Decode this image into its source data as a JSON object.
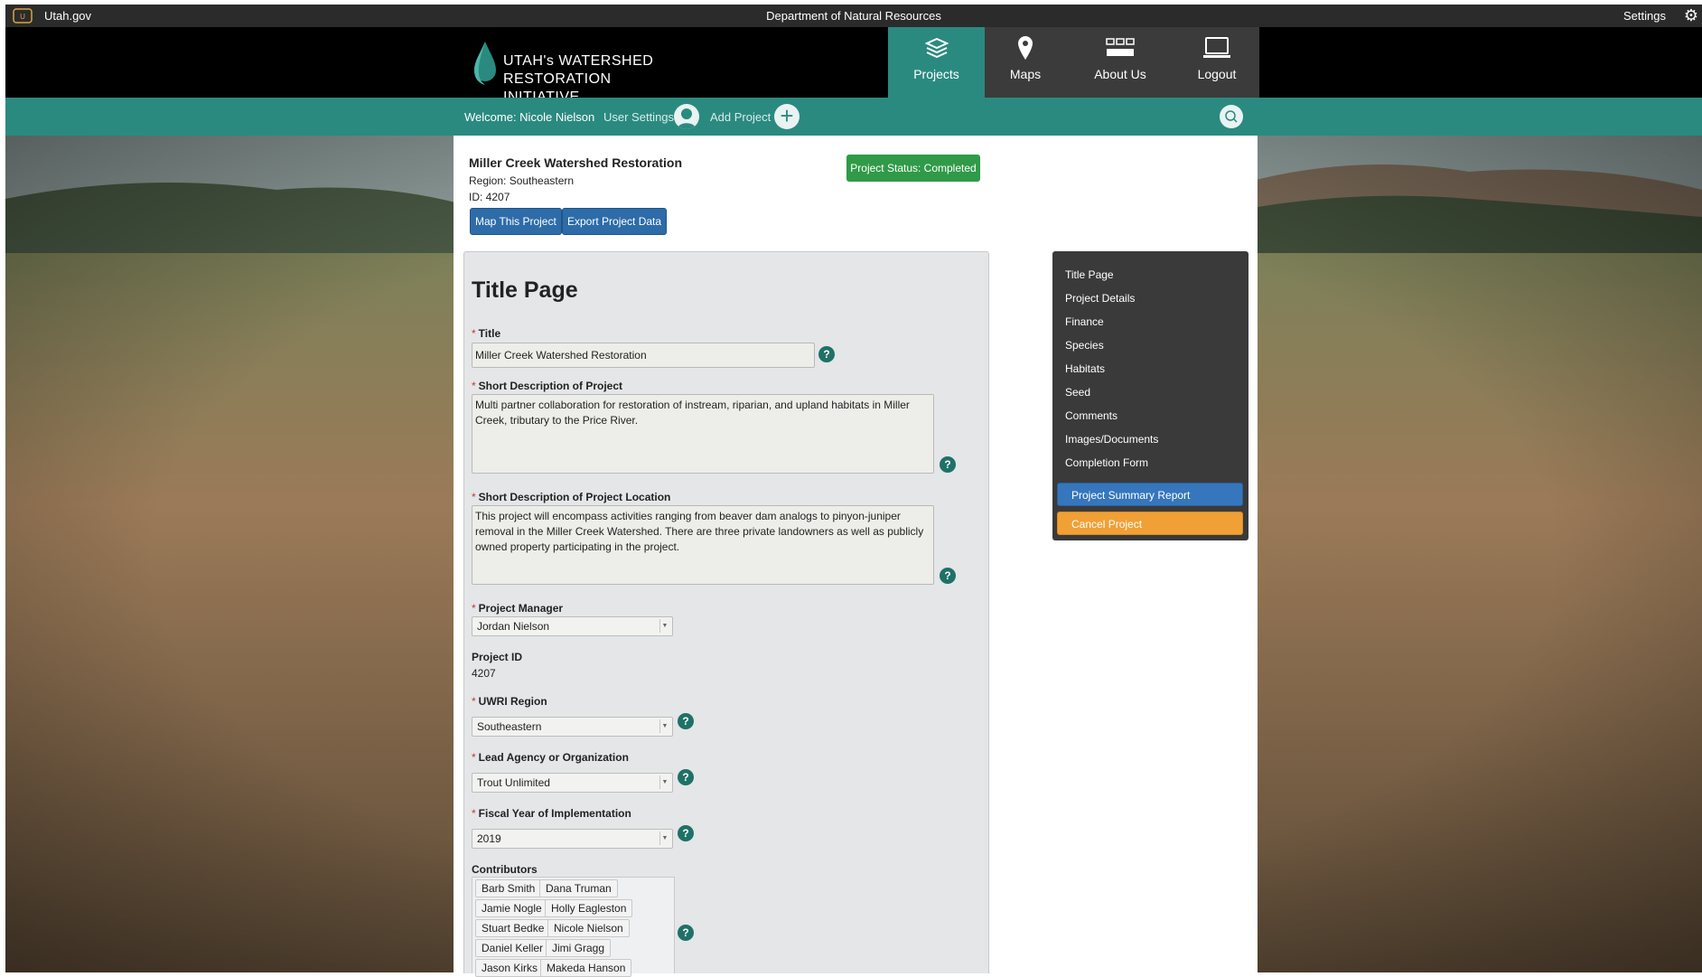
{
  "topbar": {
    "utah_link": "Utah.gov",
    "department": "Department of Natural Resources",
    "settings": "Settings"
  },
  "brand": {
    "line1": "UTAH's WATERSHED",
    "line2": "RESTORATION INITIATIVE"
  },
  "nav": {
    "items": [
      {
        "label": "Projects",
        "icon": "layers-icon",
        "active": true
      },
      {
        "label": "Maps",
        "icon": "map-pin-icon"
      },
      {
        "label": "About Us",
        "icon": "grid-icon"
      },
      {
        "label": "Logout",
        "icon": "laptop-icon"
      }
    ]
  },
  "welcome": {
    "text": "Welcome: Nicole Nielson",
    "user_settings": "User Settings",
    "add_project": "Add Project"
  },
  "project": {
    "title": "Miller Creek Watershed Restoration",
    "region": "Region: Southeastern",
    "id": "ID: 4207",
    "status": "Project Status: Completed",
    "map_button": "Map This Project",
    "export_button": "Export Project Data"
  },
  "form": {
    "heading": "Title Page",
    "title_label": "Title",
    "title_value": "Miller Creek Watershed Restoration",
    "short_desc_label": "Short Description of Project",
    "short_desc_value": "Multi partner collaboration for restoration of instream, riparian, and upland habitats in Miller Creek, tributary to the Price River.",
    "location_label": "Short Description of Project Location",
    "location_value": "This project will encompass activities ranging from beaver dam analogs to pinyon-juniper removal in the Miller Creek Watershed.  There are three private landowners as well as publicly owned property participating in the project.",
    "manager_label": "Project Manager",
    "manager_value": "Jordan Nielson",
    "project_id_label": "Project ID",
    "project_id_value": "4207",
    "region_label": "UWRI Region",
    "region_value": "Southeastern",
    "agency_label": "Lead Agency or Organization",
    "agency_value": "Trout Unlimited",
    "fiscal_label": "Fiscal Year of Implementation",
    "fiscal_value": "2019",
    "contributors_label": "Contributors",
    "contributors": [
      "Barb Smith",
      "Dana Truman",
      "Jamie Nogle",
      "Holly Eagleston",
      "Stuart Bedke",
      "Nicole Nielson",
      "Daniel Keller",
      "Jimi Gragg",
      "Jason Kirks",
      "Makeda Hanson"
    ],
    "help_symbol": "?"
  },
  "side_menu": {
    "items": [
      "Title Page",
      "Project Details",
      "Finance",
      "Species",
      "Habitats",
      "Seed",
      "Comments",
      "Images/Documents",
      "Completion Form"
    ],
    "summary_button": "Project Summary Report",
    "cancel_button": "Cancel Project"
  },
  "colors": {
    "teal": "#2a8a80",
    "status_green": "#2f9a47",
    "button_blue": "#2d6ca9",
    "cancel_orange": "#f0a035"
  }
}
